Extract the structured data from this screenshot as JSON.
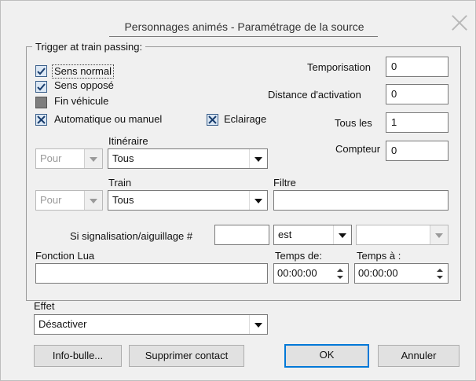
{
  "window": {
    "title": "Personnages animés - Paramétrage de la source"
  },
  "trigger": {
    "legend": "Trigger at train passing:",
    "checks": [
      {
        "label": "Sens normal",
        "state": "checked"
      },
      {
        "label": "Sens opposé",
        "state": "checked"
      },
      {
        "label": "Fin véhicule",
        "state": "indeterminate"
      },
      {
        "label": "Automatique ou manuel",
        "state": "x"
      },
      {
        "label": "Eclairage",
        "state": "x"
      }
    ],
    "fields": [
      {
        "label": "Temporisation",
        "value": "0"
      },
      {
        "label": "Distance d'activation",
        "value": "0"
      },
      {
        "label": "Tous les",
        "value": "1"
      },
      {
        "label": "Compteur",
        "value": "0"
      }
    ],
    "itineraire": {
      "label": "Itinéraire",
      "prefix": "Pour",
      "value": "Tous"
    },
    "train": {
      "label": "Train",
      "prefix": "Pour",
      "value": "Tous"
    },
    "filtre": {
      "label": "Filtre",
      "value": ""
    },
    "signal": {
      "label": "Si signalisation/aiguillage #",
      "number": "",
      "operator": "est",
      "state": ""
    },
    "lua": {
      "label": "Fonction Lua",
      "value": ""
    },
    "temps_de": {
      "label": "Temps de:",
      "value": "00:00:00"
    },
    "temps_a": {
      "label": "Temps à :",
      "value": "00:00:00"
    }
  },
  "effet": {
    "label": "Effet",
    "value": "Désactiver"
  },
  "buttons": {
    "info": "Info-bulle...",
    "supprimer": "Supprimer contact",
    "ok": "OK",
    "annuler": "Annuler"
  },
  "colors": {
    "accent": "#0078d7",
    "checkbox_fill": "#dbe7f4"
  }
}
